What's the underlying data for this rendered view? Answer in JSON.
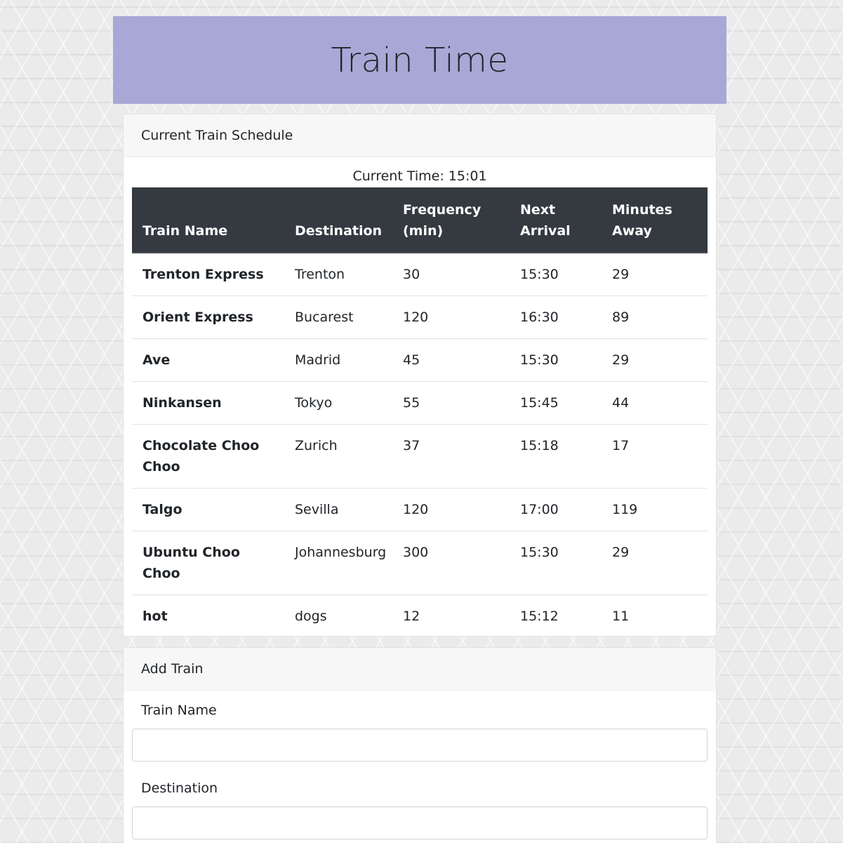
{
  "header": {
    "title": "Train Time"
  },
  "schedule": {
    "card_title": "Current Train Schedule",
    "current_time_label": "Current Time: 15:01",
    "columns": {
      "name": "Train Name",
      "destination": "Destination",
      "frequency": "Frequency (min)",
      "next_arrival": "Next Arrival",
      "minutes_away": "Minutes Away"
    },
    "rows": [
      {
        "name": "Trenton Express",
        "destination": "Trenton",
        "frequency": "30",
        "next_arrival": "15:30",
        "minutes_away": "29"
      },
      {
        "name": "Orient Express",
        "destination": "Bucarest",
        "frequency": "120",
        "next_arrival": "16:30",
        "minutes_away": "89"
      },
      {
        "name": "Ave",
        "destination": "Madrid",
        "frequency": "45",
        "next_arrival": "15:30",
        "minutes_away": "29"
      },
      {
        "name": "Ninkansen",
        "destination": "Tokyo",
        "frequency": "55",
        "next_arrival": "15:45",
        "minutes_away": "44"
      },
      {
        "name": "Chocolate Choo Choo",
        "destination": "Zurich",
        "frequency": "37",
        "next_arrival": "15:18",
        "minutes_away": "17"
      },
      {
        "name": "Talgo",
        "destination": "Sevilla",
        "frequency": "120",
        "next_arrival": "17:00",
        "minutes_away": "119"
      },
      {
        "name": "Ubuntu Choo Choo",
        "destination": "Johannesburg",
        "frequency": "300",
        "next_arrival": "15:30",
        "minutes_away": "29"
      },
      {
        "name": "hot",
        "destination": "dogs",
        "frequency": "12",
        "next_arrival": "15:12",
        "minutes_away": "11"
      }
    ]
  },
  "add_train": {
    "card_title": "Add Train",
    "fields": {
      "train_name": {
        "label": "Train Name",
        "value": ""
      },
      "destination": {
        "label": "Destination",
        "value": ""
      }
    }
  },
  "colors": {
    "header_bg": "#a8a8d6",
    "table_head_bg": "#343a40"
  }
}
